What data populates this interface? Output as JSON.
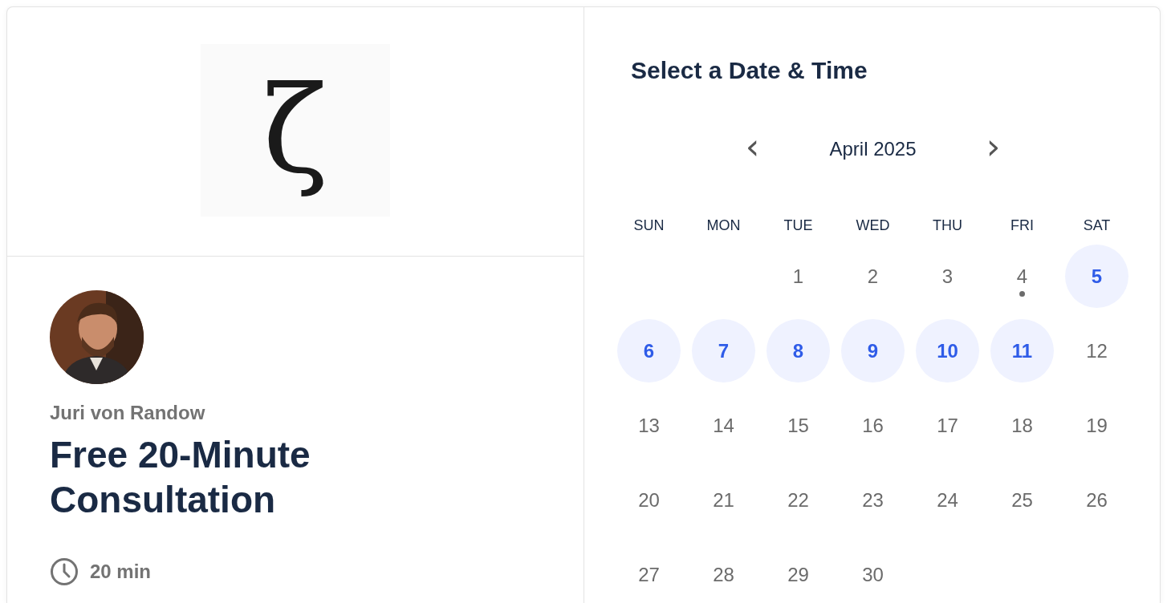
{
  "logo": {
    "text": "ζ"
  },
  "host": {
    "name": "Juri von Randow"
  },
  "event": {
    "title": "Free 20-Minute Consultation",
    "duration": "20 min"
  },
  "scheduler": {
    "heading": "Select a Date & Time",
    "month": "April 2025",
    "prev_label": "‹",
    "next_label": "›",
    "weekdays": [
      "SUN",
      "MON",
      "TUE",
      "WED",
      "THU",
      "FRI",
      "SAT"
    ],
    "weeks": [
      [
        {
          "day": "1",
          "available": false,
          "today": false
        },
        {
          "day": "2",
          "available": false,
          "today": false
        },
        {
          "day": "3",
          "available": false,
          "today": false
        },
        {
          "day": "4",
          "available": false,
          "today": true
        },
        {
          "day": "5",
          "available": true,
          "today": false
        }
      ],
      [
        {
          "day": "6",
          "available": true,
          "today": false
        },
        {
          "day": "7",
          "available": true,
          "today": false
        },
        {
          "day": "8",
          "available": true,
          "today": false
        },
        {
          "day": "9",
          "available": true,
          "today": false
        },
        {
          "day": "10",
          "available": true,
          "today": false
        },
        {
          "day": "11",
          "available": true,
          "today": false
        },
        {
          "day": "12",
          "available": false,
          "today": false
        }
      ],
      [
        {
          "day": "13",
          "available": false,
          "today": false
        },
        {
          "day": "14",
          "available": false,
          "today": false
        },
        {
          "day": "15",
          "available": false,
          "today": false
        },
        {
          "day": "16",
          "available": false,
          "today": false
        },
        {
          "day": "17",
          "available": false,
          "today": false
        },
        {
          "day": "18",
          "available": false,
          "today": false
        },
        {
          "day": "19",
          "available": false,
          "today": false
        }
      ],
      [
        {
          "day": "20",
          "available": false,
          "today": false
        },
        {
          "day": "21",
          "available": false,
          "today": false
        },
        {
          "day": "22",
          "available": false,
          "today": false
        },
        {
          "day": "23",
          "available": false,
          "today": false
        },
        {
          "day": "24",
          "available": false,
          "today": false
        },
        {
          "day": "25",
          "available": false,
          "today": false
        },
        {
          "day": "26",
          "available": false,
          "today": false
        }
      ],
      [
        {
          "day": "27",
          "available": false,
          "today": false
        },
        {
          "day": "28",
          "available": false,
          "today": false
        },
        {
          "day": "29",
          "available": false,
          "today": false
        },
        {
          "day": "30",
          "available": false,
          "today": false
        }
      ]
    ]
  }
}
